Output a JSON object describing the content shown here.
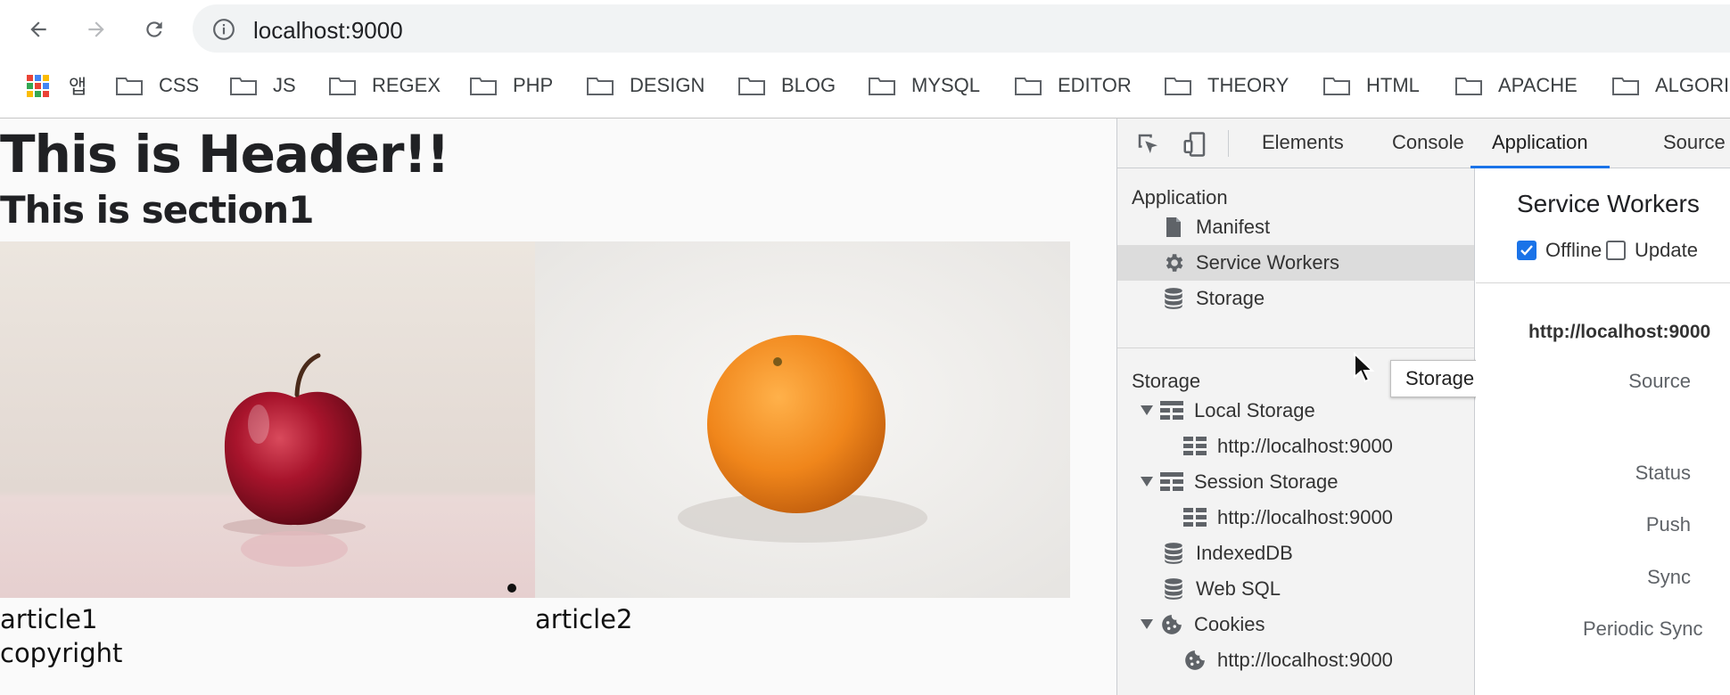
{
  "browser": {
    "url": "localhost:9000",
    "bookmarks": {
      "apps_label": "앱",
      "items": [
        "CSS",
        "JS",
        "REGEX",
        "PHP",
        "DESIGN",
        "BLOG",
        "MYSQL",
        "EDITOR",
        "THEORY",
        "HTML",
        "APACHE",
        "ALGORI"
      ]
    }
  },
  "page": {
    "header": "This is Header!!",
    "section_title": "This is section1",
    "articles": [
      "article1",
      "article2"
    ],
    "footer": "copyright"
  },
  "devtools": {
    "tabs": [
      "Elements",
      "Console",
      "Application",
      "Source"
    ],
    "active_tab": "Application",
    "sidebar": {
      "application_heading": "Application",
      "application_items": [
        "Manifest",
        "Service Workers",
        "Storage"
      ],
      "storage_heading": "Storage",
      "local_storage": "Local Storage",
      "local_storage_child": "http://localhost:9000",
      "session_storage": "Session Storage",
      "session_storage_child": "http://localhost:9000",
      "indexeddb": "IndexedDB",
      "websql": "Web SQL",
      "cookies": "Cookies",
      "cookies_child": "http://localhost:9000"
    },
    "tooltip": "Storage",
    "main": {
      "title": "Service Workers",
      "offline_label": "Offline",
      "offline_checked": true,
      "update_label": "Update",
      "origin": "http://localhost:9000",
      "labels": {
        "source": "Source",
        "status": "Status",
        "push": "Push",
        "sync": "Sync",
        "periodic_sync": "Periodic Sync"
      }
    },
    "colors": {
      "accent": "#1a73e8",
      "selected_row": "#dcdcdc"
    }
  }
}
